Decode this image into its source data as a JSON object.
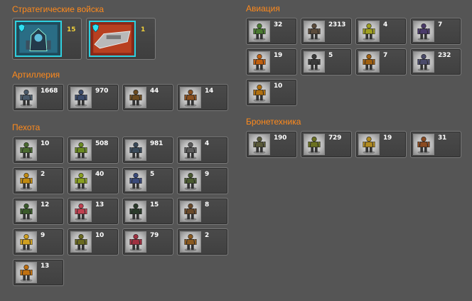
{
  "left": {
    "strategic": {
      "title": "Стратегические войска",
      "units": [
        {
          "count": "15",
          "icon": "siege-walker-icon",
          "color": "#3a5a7a"
        },
        {
          "count": "1",
          "icon": "battle-cruiser-icon",
          "color": "#8a3020"
        }
      ]
    },
    "artillery": {
      "title": "Артиллерия",
      "units": [
        {
          "count": "1668",
          "icon": "artillery-mech-icon",
          "color": "#4a5a6a"
        },
        {
          "count": "970",
          "icon": "artillery-tank-icon",
          "color": "#3a4a6a"
        },
        {
          "count": "44",
          "icon": "artillery-walker-icon",
          "color": "#6a4a20"
        },
        {
          "count": "14",
          "icon": "artillery-crawler-icon",
          "color": "#8a5020"
        }
      ]
    },
    "infantry": {
      "title": "Пехота",
      "units": [
        {
          "count": "10",
          "icon": "rifleman-icon",
          "color": "#4a6a30"
        },
        {
          "count": "508",
          "icon": "heavy-trooper-icon",
          "color": "#6a8a20"
        },
        {
          "count": "981",
          "icon": "cyborg-soldier-icon",
          "color": "#3a4a5a"
        },
        {
          "count": "4",
          "icon": "sniper-icon",
          "color": "#5a5a5a"
        },
        {
          "count": "2",
          "icon": "flamethrower-icon",
          "color": "#c08a10"
        },
        {
          "count": "40",
          "icon": "exo-brute-icon",
          "color": "#8aa020"
        },
        {
          "count": "5",
          "icon": "blue-trooper-icon",
          "color": "#3a4a7a"
        },
        {
          "count": "9",
          "icon": "gunner-crouch-icon",
          "color": "#4a5a30"
        },
        {
          "count": "12",
          "icon": "commando-icon",
          "color": "#3a5a2a"
        },
        {
          "count": "13",
          "icon": "pink-beast-icon",
          "color": "#c04050"
        },
        {
          "count": "15",
          "icon": "dark-operative-icon",
          "color": "#2a3a2a"
        },
        {
          "count": "8",
          "icon": "grenadier-icon",
          "color": "#6a4a2a"
        },
        {
          "count": "9",
          "icon": "yellow-mech-icon",
          "color": "#d0a020"
        },
        {
          "count": "10",
          "icon": "scout-icon",
          "color": "#6a6a20"
        },
        {
          "count": "79",
          "icon": "red-assault-icon",
          "color": "#a03040"
        },
        {
          "count": "2",
          "icon": "heavy-gunner-icon",
          "color": "#8a5a20"
        },
        {
          "count": "13",
          "icon": "orange-brute-icon",
          "color": "#c07010"
        }
      ]
    }
  },
  "right": {
    "aviation": {
      "title": "Авиация",
      "units": [
        {
          "count": "32",
          "icon": "green-flyer-icon",
          "color": "#4a7a30"
        },
        {
          "count": "2313",
          "icon": "bat-drone-icon",
          "color": "#5a4a3a"
        },
        {
          "count": "4",
          "icon": "yellow-flyer-icon",
          "color": "#a0a020"
        },
        {
          "count": "7",
          "icon": "claw-drone-icon",
          "color": "#4a3a6a"
        },
        {
          "count": "19",
          "icon": "fire-bat-icon",
          "color": "#c06010"
        },
        {
          "count": "5",
          "icon": "gargoyle-icon",
          "color": "#3a3a3a"
        },
        {
          "count": "7",
          "icon": "jet-trooper-icon",
          "color": "#a06010"
        },
        {
          "count": "232",
          "icon": "dragon-flyer-icon",
          "color": "#4a4a6a"
        },
        {
          "count": "10",
          "icon": "scorpion-flyer-icon",
          "color": "#b07010"
        }
      ]
    },
    "armor": {
      "title": "Бронетехника",
      "units": [
        {
          "count": "190",
          "icon": "hover-tank-icon",
          "color": "#5a5a3a"
        },
        {
          "count": "729",
          "icon": "green-tank-icon",
          "color": "#6a7020"
        },
        {
          "count": "19",
          "icon": "gold-tank-icon",
          "color": "#b08a20"
        },
        {
          "count": "31",
          "icon": "rust-tank-icon",
          "color": "#8a4a20"
        }
      ]
    }
  }
}
